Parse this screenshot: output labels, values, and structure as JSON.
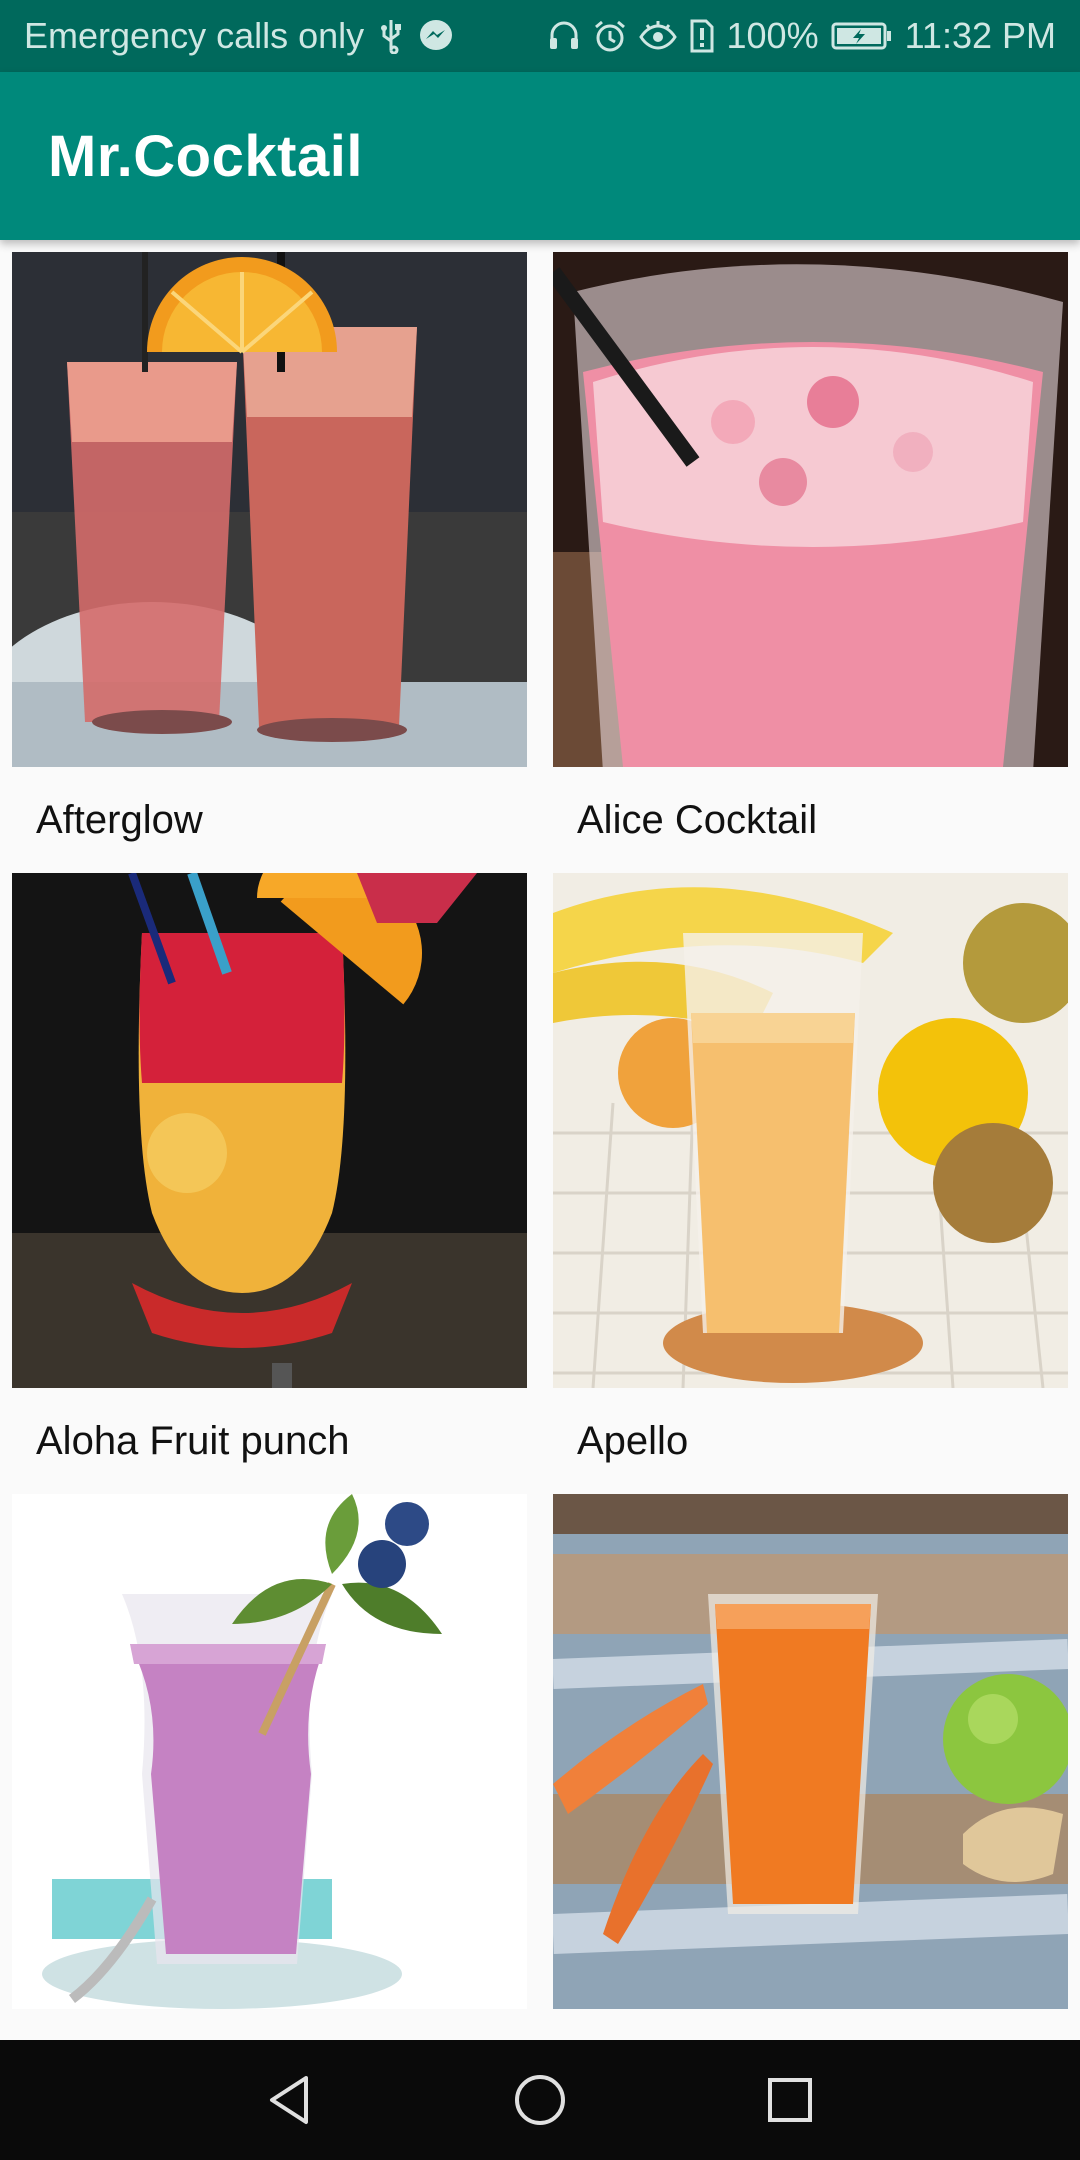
{
  "status_bar": {
    "carrier_text": "Emergency calls only",
    "battery_percent": "100%",
    "time": "11:32 PM",
    "left_icons": [
      "usb-icon",
      "messenger-icon"
    ],
    "right_icons": [
      "headset-icon",
      "alarm-icon",
      "eye-comfort-icon",
      "storage-alert-icon",
      "battery-charging-icon"
    ]
  },
  "app_bar": {
    "title": "Mr.Cocktail",
    "background": "#00897b",
    "status_background": "#00695c"
  },
  "cocktails": [
    {
      "name": "Afterglow",
      "image": "two-pink-drinks-with-orange-slice"
    },
    {
      "name": "Alice Cocktail",
      "image": "pink-frothy-drink-with-straw"
    },
    {
      "name": "Aloha Fruit punch",
      "image": "red-orange-layered-drink-with-orange"
    },
    {
      "name": "Apello",
      "image": "peach-juice-glass-with-fruits"
    },
    {
      "name": "",
      "image": "purple-smoothie-with-blueberries"
    },
    {
      "name": "",
      "image": "carrot-juice-glass-with-apple"
    }
  ],
  "nav_bar": {
    "buttons": [
      "back-button",
      "home-button",
      "recents-button"
    ]
  }
}
